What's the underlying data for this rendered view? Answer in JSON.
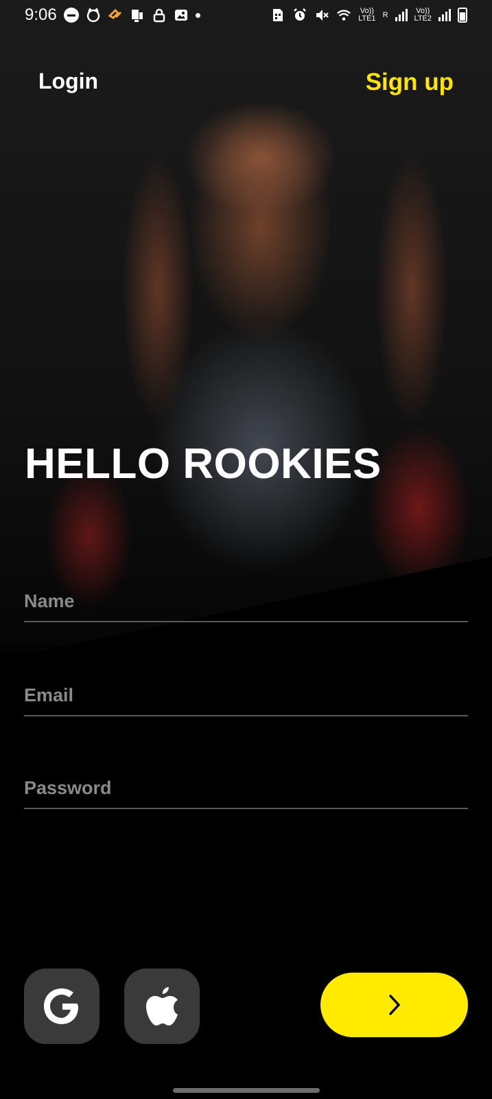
{
  "status_bar": {
    "time": "9:06",
    "net1_top": "Vo))",
    "net1_bottom": "LTE1",
    "roaming": "R",
    "net2_top": "Vo))",
    "net2_bottom": "LTE2"
  },
  "nav": {
    "login_label": "Login",
    "signup_label": "Sign up"
  },
  "title": "HELLO ROOKIES",
  "form": {
    "name_placeholder": "Name",
    "email_placeholder": "Email",
    "password_placeholder": "Password"
  },
  "icons": {
    "google": "google-icon",
    "apple": "apple-icon",
    "next": "chevron-right-icon"
  },
  "colors": {
    "accent": "#FFE500",
    "button_yellow": "#FFEA00",
    "social_bg": "#3A3A3A",
    "background": "#000000"
  }
}
